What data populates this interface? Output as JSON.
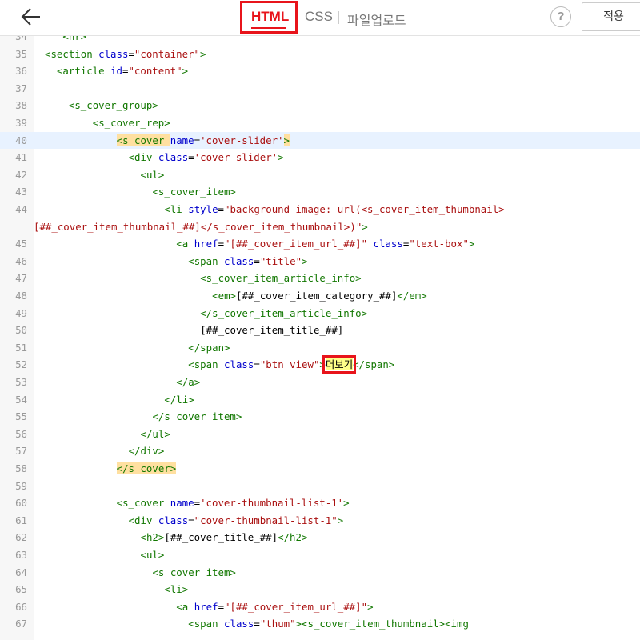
{
  "header": {
    "tabs": [
      {
        "label": "HTML",
        "active": true
      },
      {
        "label": "CSS"
      },
      {
        "label": "파일업로드"
      }
    ],
    "help_label": "?",
    "apply_label": "적용"
  },
  "colors": {
    "accent": "#e8141b",
    "tag": "#117700",
    "attr": "#0000cc",
    "string": "#aa1111",
    "active_line": "#e8f2ff",
    "match_highlight": "#ffe0a0"
  },
  "editor": {
    "active_line": 40,
    "lines": [
      {
        "n": "34",
        "segs": [
          [
            "t",
            "<hr>"
          ]
        ],
        "indent": 4
      },
      {
        "n": "35",
        "segs": [
          [
            "t",
            "<section "
          ],
          [
            "a",
            "class"
          ],
          [
            "p",
            "="
          ],
          [
            "s",
            "\"container\""
          ],
          [
            "t",
            ">"
          ]
        ],
        "indent": 1
      },
      {
        "n": "36",
        "segs": [
          [
            "t",
            "<article "
          ],
          [
            "a",
            "id"
          ],
          [
            "p",
            "="
          ],
          [
            "s",
            "\"content\""
          ],
          [
            "t",
            ">"
          ]
        ],
        "indent": 3
      },
      {
        "n": "37",
        "segs": [],
        "indent": 0
      },
      {
        "n": "38",
        "segs": [
          [
            "t",
            "<s_cover_group>"
          ]
        ],
        "indent": 5
      },
      {
        "n": "39",
        "segs": [
          [
            "t",
            "<s_cover_rep>"
          ]
        ],
        "indent": 9
      },
      {
        "n": "40",
        "segs": [
          [
            "th",
            "<s_cover "
          ],
          [
            "a",
            "name"
          ],
          [
            "p",
            "="
          ],
          [
            "s",
            "'cover-slider'"
          ],
          [
            "th",
            ">"
          ]
        ],
        "indent": 13
      },
      {
        "n": "41",
        "segs": [
          [
            "t",
            "<div "
          ],
          [
            "a",
            "class"
          ],
          [
            "p",
            "="
          ],
          [
            "s",
            "'cover-slider'"
          ],
          [
            "t",
            ">"
          ]
        ],
        "indent": 15
      },
      {
        "n": "42",
        "segs": [
          [
            "t",
            "<ul>"
          ]
        ],
        "indent": 17
      },
      {
        "n": "43",
        "segs": [
          [
            "t",
            "<s_cover_item>"
          ]
        ],
        "indent": 19
      },
      {
        "n": "44",
        "segs": [
          [
            "t",
            "<li "
          ],
          [
            "a",
            "style"
          ],
          [
            "p",
            "="
          ],
          [
            "s",
            "\"background-image: url(<s_cover_item_thumbnail>"
          ]
        ],
        "indent": 21
      },
      {
        "n": "",
        "segs": [
          [
            "s",
            "[##_cover_item_thumbnail_##]</s_cover_item_thumbnail>)\""
          ],
          [
            "t",
            ">"
          ]
        ],
        "indent": 0
      },
      {
        "n": "45",
        "segs": [
          [
            "t",
            "<a "
          ],
          [
            "a",
            "href"
          ],
          [
            "p",
            "="
          ],
          [
            "s",
            "\"[##_cover_item_url_##]\""
          ],
          [
            "p",
            " "
          ],
          [
            "a",
            "class"
          ],
          [
            "p",
            "="
          ],
          [
            "s",
            "\"text-box\""
          ],
          [
            "t",
            ">"
          ]
        ],
        "indent": 23
      },
      {
        "n": "46",
        "segs": [
          [
            "t",
            "<span "
          ],
          [
            "a",
            "class"
          ],
          [
            "p",
            "="
          ],
          [
            "s",
            "\"title\""
          ],
          [
            "t",
            ">"
          ]
        ],
        "indent": 25
      },
      {
        "n": "47",
        "segs": [
          [
            "t",
            "<s_cover_item_article_info>"
          ]
        ],
        "indent": 27
      },
      {
        "n": "48",
        "segs": [
          [
            "t",
            "<em>"
          ],
          [
            "p",
            "[##_cover_item_category_##]"
          ],
          [
            "t",
            "</em>"
          ]
        ],
        "indent": 29
      },
      {
        "n": "49",
        "segs": [
          [
            "t",
            "</s_cover_item_article_info>"
          ]
        ],
        "indent": 27
      },
      {
        "n": "50",
        "segs": [
          [
            "p",
            "[##_cover_item_title_##]"
          ]
        ],
        "indent": 27
      },
      {
        "n": "51",
        "segs": [
          [
            "t",
            "</span>"
          ]
        ],
        "indent": 25
      },
      {
        "n": "52",
        "segs": [
          [
            "t",
            "<span "
          ],
          [
            "a",
            "class"
          ],
          [
            "p",
            "="
          ],
          [
            "s",
            "\"btn view\""
          ],
          [
            "t",
            ">"
          ],
          [
            "m",
            "더보기"
          ],
          [
            "t",
            "</span>"
          ]
        ],
        "indent": 25
      },
      {
        "n": "53",
        "segs": [
          [
            "t",
            "</a>"
          ]
        ],
        "indent": 23
      },
      {
        "n": "54",
        "segs": [
          [
            "t",
            "</li>"
          ]
        ],
        "indent": 21
      },
      {
        "n": "55",
        "segs": [
          [
            "t",
            "</s_cover_item>"
          ]
        ],
        "indent": 19
      },
      {
        "n": "56",
        "segs": [
          [
            "t",
            "</ul>"
          ]
        ],
        "indent": 17
      },
      {
        "n": "57",
        "segs": [
          [
            "t",
            "</div>"
          ]
        ],
        "indent": 15
      },
      {
        "n": "58",
        "segs": [
          [
            "th",
            "</s_cover>"
          ]
        ],
        "indent": 13
      },
      {
        "n": "59",
        "segs": [],
        "indent": 0
      },
      {
        "n": "60",
        "segs": [
          [
            "t",
            "<s_cover "
          ],
          [
            "a",
            "name"
          ],
          [
            "p",
            "="
          ],
          [
            "s",
            "'cover-thumbnail-list-1'"
          ],
          [
            "t",
            ">"
          ]
        ],
        "indent": 13
      },
      {
        "n": "61",
        "segs": [
          [
            "t",
            "<div "
          ],
          [
            "a",
            "class"
          ],
          [
            "p",
            "="
          ],
          [
            "s",
            "\"cover-thumbnail-list-1\""
          ],
          [
            "t",
            ">"
          ]
        ],
        "indent": 15
      },
      {
        "n": "62",
        "segs": [
          [
            "t",
            "<h2>"
          ],
          [
            "p",
            "[##_cover_title_##]"
          ],
          [
            "t",
            "</h2>"
          ]
        ],
        "indent": 17
      },
      {
        "n": "63",
        "segs": [
          [
            "t",
            "<ul>"
          ]
        ],
        "indent": 17
      },
      {
        "n": "64",
        "segs": [
          [
            "t",
            "<s_cover_item>"
          ]
        ],
        "indent": 19
      },
      {
        "n": "65",
        "segs": [
          [
            "t",
            "<li>"
          ]
        ],
        "indent": 21
      },
      {
        "n": "66",
        "segs": [
          [
            "t",
            "<a "
          ],
          [
            "a",
            "href"
          ],
          [
            "p",
            "="
          ],
          [
            "s",
            "\"[##_cover_item_url_##]\""
          ],
          [
            "t",
            ">"
          ]
        ],
        "indent": 23
      },
      {
        "n": "67",
        "segs": [
          [
            "t",
            "<span "
          ],
          [
            "a",
            "class"
          ],
          [
            "p",
            "="
          ],
          [
            "s",
            "\"thum\""
          ],
          [
            "t",
            ">"
          ],
          [
            "t",
            "<s_cover_item_thumbnail>"
          ],
          [
            "t",
            "<img"
          ]
        ],
        "indent": 25
      }
    ]
  }
}
